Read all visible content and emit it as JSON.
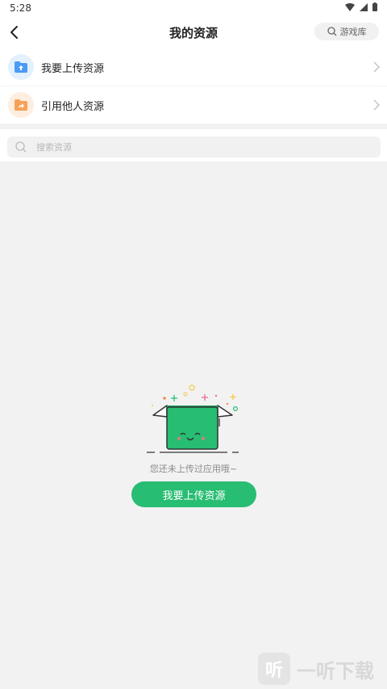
{
  "status_bar": {
    "time": "5:28"
  },
  "header": {
    "title": "我的资源",
    "game_library_label": "游戏库"
  },
  "entries": [
    {
      "label": "我要上传资源",
      "icon": "folder-upload-icon",
      "color": "#4a9bf4"
    },
    {
      "label": "引用他人资源",
      "icon": "folder-share-icon",
      "color": "#f7a158"
    }
  ],
  "search": {
    "placeholder": "搜索资源",
    "value": ""
  },
  "empty_state": {
    "message": "您还未上传过应用哦~",
    "button_label": "我要上传资源",
    "accent": "#27bd72"
  },
  "watermark": {
    "text": "一听下载",
    "logo_char": "听"
  }
}
